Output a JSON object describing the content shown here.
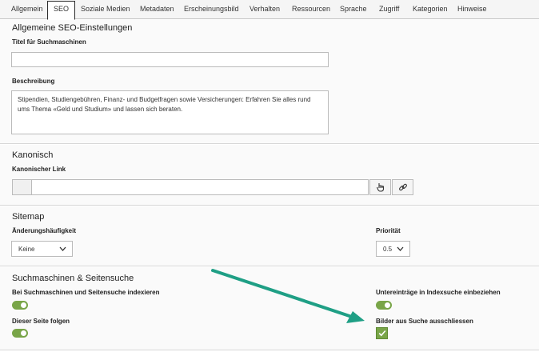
{
  "tabs": [
    {
      "label": "Allgemein"
    },
    {
      "label": "SEO"
    },
    {
      "label": "Soziale Medien"
    },
    {
      "label": "Metadaten"
    },
    {
      "label": "Erscheinungsbild"
    },
    {
      "label": "Verhalten"
    },
    {
      "label": "Ressourcen"
    },
    {
      "label": "Sprache"
    },
    {
      "label": "Zugriff"
    },
    {
      "label": "Kategorien"
    },
    {
      "label": "Hinweise"
    }
  ],
  "seo": {
    "title": "Allgemeine SEO-Einstellungen",
    "title_field_label": "Titel für Suchmaschinen",
    "title_field_value": "",
    "description_label": "Beschreibung",
    "description_value": "Stipendien, Studiengebühren, Finanz- und Budgetfragen sowie Versicherungen: Erfahren Sie alles rund ums Thema «Geld und Studium» und lassen sich beraten."
  },
  "canonical": {
    "title": "Kanonisch",
    "link_label": "Kanonischer Link",
    "link_value": "",
    "pick_icon": "hand-pointer-icon",
    "link_icon": "link-icon"
  },
  "sitemap": {
    "title": "Sitemap",
    "frequency_label": "Änderungshäufigkeit",
    "frequency_value": "Keine",
    "priority_label": "Priorität",
    "priority_value": "0.5"
  },
  "search": {
    "title": "Suchmaschinen & Seitensuche",
    "index_label": "Bei Suchmaschinen und Seitensuche indexieren",
    "index_on": true,
    "follow_label": "Dieser Seite folgen",
    "follow_on": true,
    "subentries_label": "Untereinträge in Indexsuche einbeziehen",
    "subentries_on": true,
    "exclude_images_label": "Bilder aus Suche ausschliessen",
    "exclude_images_checked": true
  },
  "colors": {
    "toggle_on": "#79a548",
    "arrow": "#1f9f85"
  }
}
